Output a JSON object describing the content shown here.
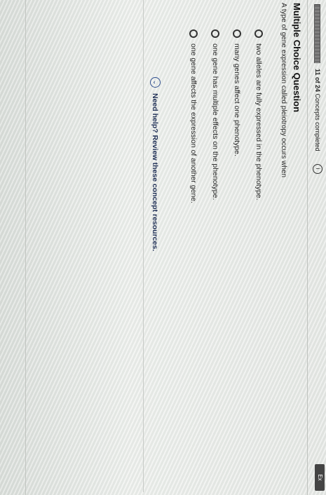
{
  "header": {
    "progress_value": 0.46,
    "progress_strong": "11 of 24",
    "progress_rest": "Concepts completed",
    "info_icon": "info-icon",
    "ex_tab": "Ex"
  },
  "question": {
    "heading": "Multiple Choice Question",
    "prompt": "A type of gene expression called pleiotropy occurs when",
    "options": [
      "two alleles are fully expressed in the phenotype.",
      "many genes affect one phenotype.",
      "one gene has multiple effects on the phenotype.",
      "one gene affects the expression of another gene."
    ]
  },
  "help": {
    "icon": "chevron-down-icon",
    "label": "Need help? Review these concept resources."
  }
}
